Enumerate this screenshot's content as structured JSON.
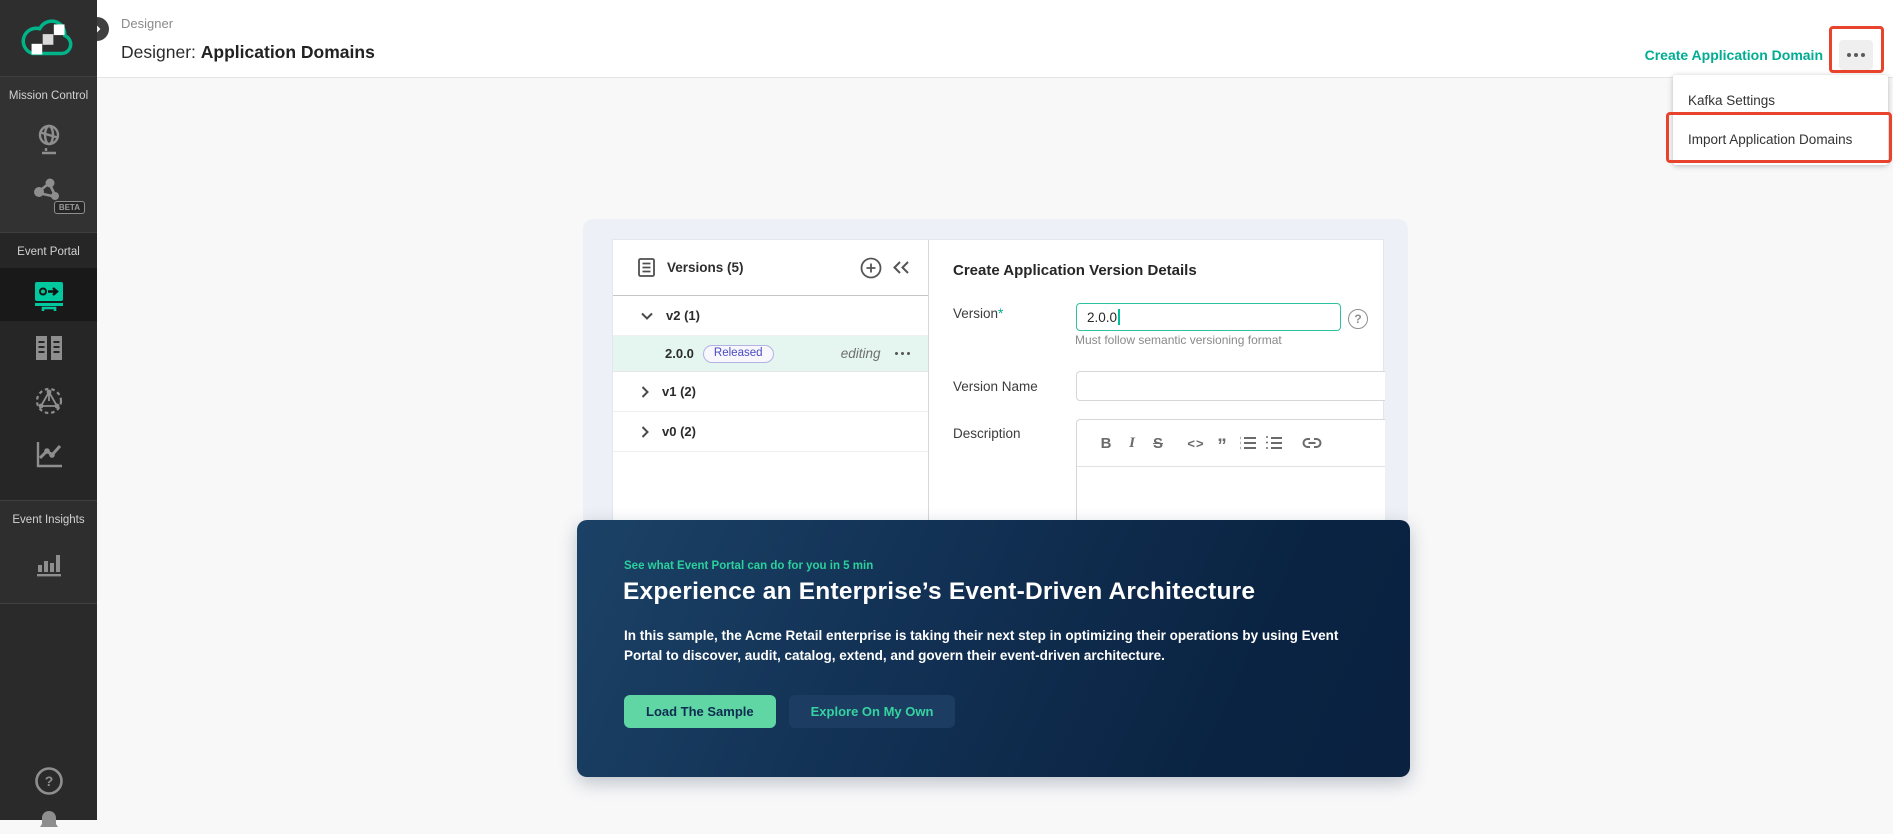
{
  "sidebar": {
    "sections": {
      "mission_control": {
        "label": "Mission Control"
      },
      "event_portal": {
        "label": "Event Portal"
      },
      "event_insights": {
        "label": "Event Insights"
      }
    },
    "beta_badge": "BETA"
  },
  "header": {
    "breadcrumb": "Designer",
    "title_prefix": "Designer:",
    "title": "Application Domains",
    "create_link": "Create Application Domain"
  },
  "menu": {
    "items": [
      {
        "label": "Kafka Settings"
      },
      {
        "label": "Import Application Domains"
      }
    ]
  },
  "versions_panel": {
    "title": "Versions (5)",
    "groups": [
      {
        "label": "v2 (1)"
      },
      {
        "label": "v1 (2)"
      },
      {
        "label": "v0 (2)"
      }
    ],
    "selected_version": {
      "number": "2.0.0",
      "badge": "Released",
      "status": "editing"
    }
  },
  "form": {
    "title": "Create Application Version Details",
    "version_label": "Version",
    "required_mark": "*",
    "version_value": "2.0.0",
    "version_hint": "Must follow semantic versioning format",
    "version_name_label": "Version Name",
    "description_label": "Description",
    "toolbar": {
      "bold": "B",
      "italic": "I",
      "strike": "S",
      "code": "<>",
      "quote": "”"
    }
  },
  "banner": {
    "eyebrow": "See what Event Portal can do for you in 5 min",
    "heading": "Experience an Enterprise’s Event-Driven Architecture",
    "body": "In this sample, the Acme Retail enterprise is taking their next step in optimizing their operations by using Event Portal to discover, audit, catalog, extend, and govern their event-driven architecture.",
    "primary_button": "Load The Sample",
    "secondary_button": "Explore On My Own"
  },
  "colors": {
    "accent_teal": "#00ad93",
    "banner_green": "#2bd09c",
    "annotation_red": "#e8432d",
    "released_badge_text": "#4a4ac0",
    "selected_row_bg": "#e4f6ef"
  }
}
